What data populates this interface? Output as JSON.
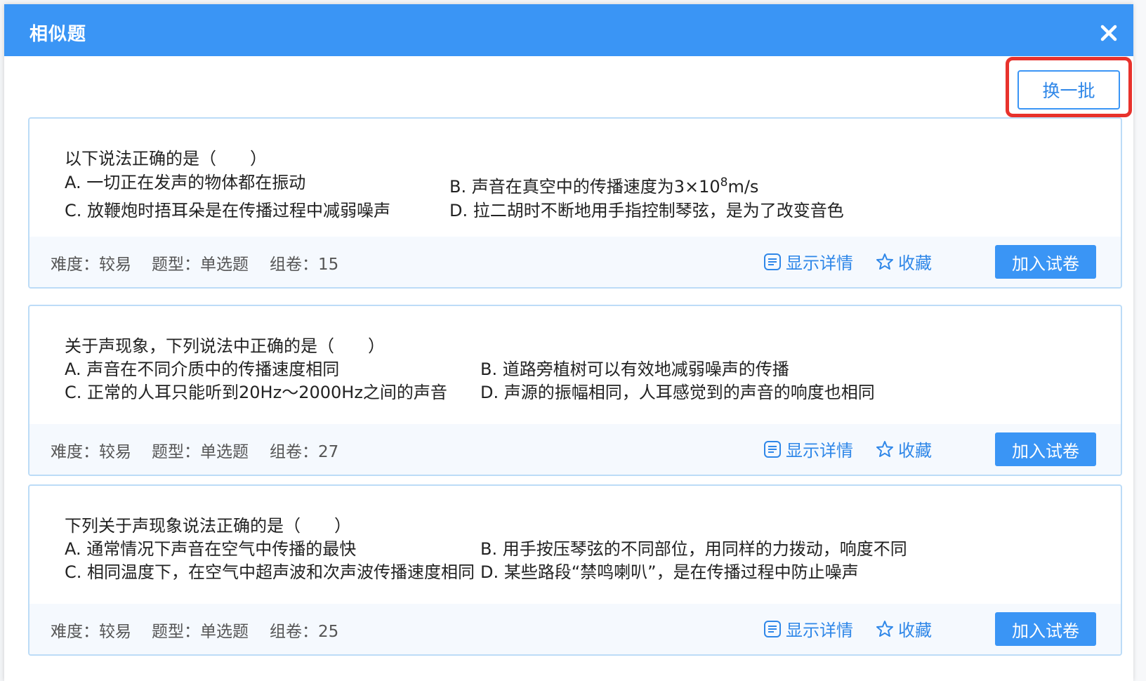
{
  "dialog": {
    "title": "相似题",
    "close_icon": "close-icon",
    "refresh_label": "换一批"
  },
  "questions": [
    {
      "stem": "以下说法正确的是（　　）",
      "options": {
        "a": "A. 一切正在发声的物体都在振动",
        "b_pre": "B. 声音在真空中的传播速度为3×10",
        "b_sup": "8",
        "b_post": "m/s",
        "c": "C. 放鞭炮时捂耳朵是在传播过程中减弱噪声",
        "d": "D. 拉二胡时不断地用手指控制琴弦，是为了改变音色"
      },
      "difficulty_label": "难度：",
      "difficulty": "较易",
      "type_label": "题型：",
      "type": "单选题",
      "count_label": "组卷：",
      "count": "15",
      "details_label": "显示详情",
      "favorite_label": "收藏",
      "add_label": "加入试卷"
    },
    {
      "stem": "关于声现象，下列说法中正确的是（　　）",
      "options": {
        "a": "A. 声音在不同介质中的传播速度相同",
        "b": "B. 道路旁植树可以有效地减弱噪声的传播",
        "c": "C. 正常的人耳只能听到20Hz～2000Hz之间的声音",
        "d": "D. 声源的振幅相同，人耳感觉到的声音的响度也相同"
      },
      "difficulty_label": "难度：",
      "difficulty": "较易",
      "type_label": "题型：",
      "type": "单选题",
      "count_label": "组卷：",
      "count": "27",
      "details_label": "显示详情",
      "favorite_label": "收藏",
      "add_label": "加入试卷"
    },
    {
      "stem": "下列关于声现象说法正确的是（　　）",
      "options": {
        "a": "A. 通常情况下声音在空气中传播的最快",
        "b": "B. 用手按压琴弦的不同部位，用同样的力拨动，响度不同",
        "c": "C. 相同温度下，在空气中超声波和次声波传播速度相同",
        "d": "D. 某些路段“禁鸣喇叭”，是在传播过程中防止噪声"
      },
      "difficulty_label": "难度：",
      "difficulty": "较易",
      "type_label": "题型：",
      "type": "单选题",
      "count_label": "组卷：",
      "count": "25",
      "details_label": "显示详情",
      "favorite_label": "收藏",
      "add_label": "加入试卷"
    }
  ],
  "colors": {
    "header": "#3a95f5",
    "accent": "#2f87e8",
    "highlight": "#e8322c",
    "card_border": "#bcdcf7"
  }
}
